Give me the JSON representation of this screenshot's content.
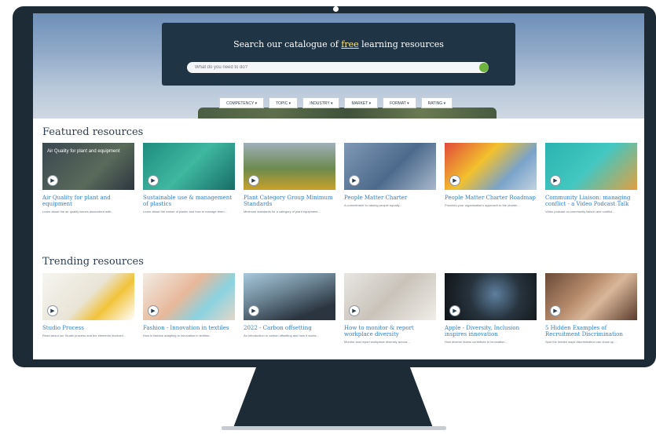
{
  "search": {
    "title_before": "Search our catalogue of",
    "title_emph": "free",
    "title_after": "learning resources",
    "placeholder": "What do you need to do?"
  },
  "filters": [
    "COMPETENCY ▾",
    "TOPIC ▾",
    "INDUSTRY ▾",
    "MARKET ▾",
    "FORMAT ▾",
    "RATING ▾"
  ],
  "featured": {
    "title": "Featured resources",
    "cards": [
      {
        "title": "Air Quality for plant and equipment",
        "overlay": "Air Quality for plant and equipment",
        "desc": "Learn about the air quality issues associated with..."
      },
      {
        "title": "Sustainable use & management of plastics",
        "overlay": "",
        "desc": "Learn about the nature of plastic and how to manage them..."
      },
      {
        "title": "Plant Category Group Minimum Standards",
        "overlay": "",
        "desc": "Minimum standards for a category of plant equipment..."
      },
      {
        "title": "People Matter Charter",
        "overlay": "",
        "desc": "A commitment to valuing people equally..."
      },
      {
        "title": "People Matter Charter Roadmap",
        "overlay": "",
        "desc": "Provides your organisation's approach to the charter..."
      },
      {
        "title": "Community Liaison: managing conflict - a Video Podcast Talk",
        "overlay": "",
        "desc": "Video podcast on community liaison and conflict..."
      }
    ]
  },
  "trending": {
    "title": "Trending resources",
    "cards": [
      {
        "title": "Studio Process",
        "desc": "Read about our Studio process and the elements involved..."
      },
      {
        "title": "Fashion - Innovation in textiles",
        "desc": "How is fashion adapting to innovation in textiles..."
      },
      {
        "title": "2022 - Carbon offsetting",
        "desc": "An introduction to carbon offsetting and how it works..."
      },
      {
        "title": "How to monitor & report workplace diversity",
        "desc": "Monitor and report workplace diversity across..."
      },
      {
        "title": "Apple - Diversity, Inclusion inspires innovation",
        "desc": "How diverse teams contribute to innovation..."
      },
      {
        "title": "5 Hidden Examples of Recruitment Discrimination",
        "desc": "Spot the hidden ways discrimination can show up..."
      }
    ]
  },
  "colors": {
    "monitor": "#1d2b37",
    "panel": "#1f3445",
    "accent": "#6db33f",
    "link": "#2f80c8"
  }
}
